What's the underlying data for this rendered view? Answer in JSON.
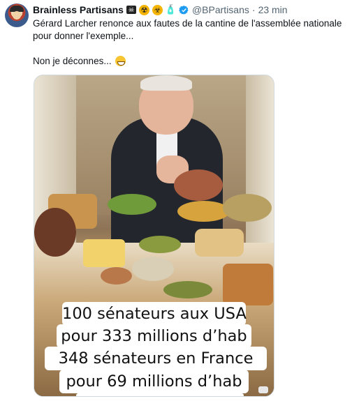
{
  "author": {
    "display_name": "Brainless Partisans",
    "handle": "@BPartisans",
    "separator": "·",
    "time": "23 min",
    "name_emojis": [
      "pirate-flag",
      "radioactive",
      "biohazard",
      "bottle"
    ]
  },
  "tweet": {
    "line1": "Gérard Larcher renonce aux fautes de la cantine de l'assemblée nationale",
    "line2": "pour donner l'exemple...",
    "line3": "Non je déconnes...",
    "line3_emoji": "grinning-face"
  },
  "media": {
    "caption_lines": [
      "100 sénateurs aux USA",
      "pour 333 millions d’hab",
      "348 sénateurs en France",
      "pour 69 millions d’hab"
    ]
  },
  "colors": {
    "text": "#0f1419",
    "secondary": "#536471",
    "verified": "#1d9bf0"
  }
}
